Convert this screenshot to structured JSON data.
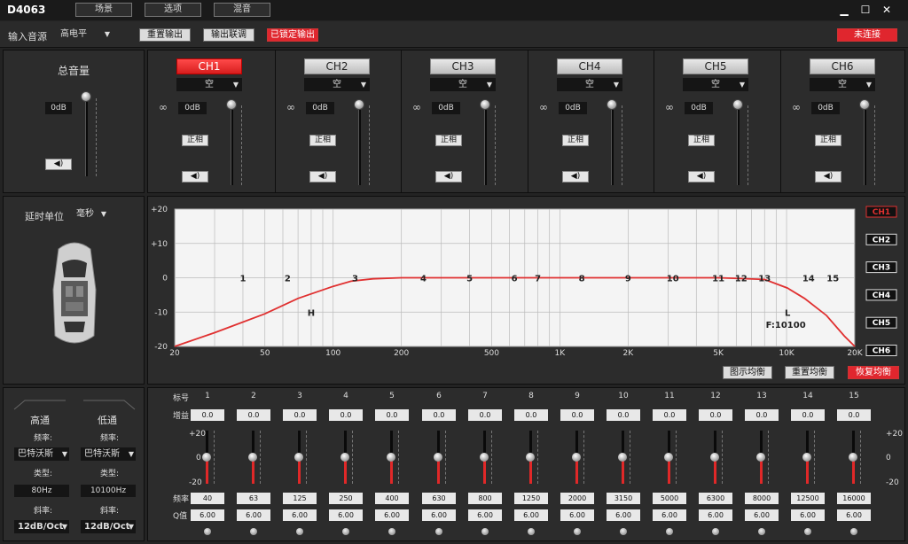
{
  "window": {
    "title": "D4063",
    "menu": [
      "场景",
      "选项",
      "混音"
    ],
    "minimize": "▁",
    "maximize": "☐",
    "close": "✕"
  },
  "toolbar": {
    "input_source_label": "输入音源",
    "input_source_value": "高电平",
    "reset_output": "重置输出",
    "output_link": "输出联调",
    "locked_output": "已锁定输出",
    "connection_status": "未连接"
  },
  "master": {
    "title": "总音量",
    "value": "0dB",
    "level": 1.0
  },
  "channels": [
    {
      "name": "CH1",
      "type": "空",
      "gain": "0dB",
      "phase": "正相",
      "active": true
    },
    {
      "name": "CH2",
      "type": "空",
      "gain": "0dB",
      "phase": "正相",
      "active": false
    },
    {
      "name": "CH3",
      "type": "空",
      "gain": "0dB",
      "phase": "正相",
      "active": false
    },
    {
      "name": "CH4",
      "type": "空",
      "gain": "0dB",
      "phase": "正相",
      "active": false
    },
    {
      "name": "CH5",
      "type": "空",
      "gain": "0dB",
      "phase": "正相",
      "active": false
    },
    {
      "name": "CH6",
      "type": "空",
      "gain": "0dB",
      "phase": "正相",
      "active": false
    }
  ],
  "delay": {
    "unit_label": "延时单位",
    "unit_value": "毫秒"
  },
  "graph": {
    "y_ticks": [
      "+20",
      "+10",
      "0",
      "-10",
      "-20"
    ],
    "x_ticks": [
      "20",
      "50",
      "100",
      "200",
      "500",
      "1K",
      "2K",
      "5K",
      "10K",
      "20K"
    ],
    "band_markers": [
      "1",
      "2",
      "3",
      "4",
      "5",
      "6",
      "7",
      "8",
      "9",
      "10",
      "11",
      "12",
      "13",
      "14",
      "15"
    ],
    "hp_marker": "H",
    "lp_marker": "L",
    "lp_freq_label": "F:10100",
    "channel_labels": [
      "CH1",
      "CH2",
      "CH3",
      "CH4",
      "CH5",
      "CH6"
    ],
    "curve_color": "#e03030",
    "buttons": {
      "graphic_eq": "图示均衡",
      "reset_eq": "重置均衡",
      "restore_eq": "恢复均衡"
    }
  },
  "chart_data": {
    "type": "line",
    "x": [
      20,
      30,
      50,
      70,
      100,
      120,
      150,
      200,
      500,
      1000,
      2000,
      5000,
      8000,
      10100,
      12000,
      15000,
      18000,
      20000
    ],
    "y": [
      -20,
      -16,
      -10.5,
      -6,
      -2.5,
      -1,
      -0.3,
      0,
      0,
      0,
      0,
      0,
      -0.5,
      -3,
      -6,
      -11,
      -17,
      -20
    ],
    "xlim": [
      20,
      20000
    ],
    "ylim": [
      -20,
      20
    ],
    "xscale": "log",
    "grid": true
  },
  "filters": {
    "highpass": {
      "title": "高通",
      "freq_label": "频率:",
      "type_value": "巴特沃斯",
      "type_label": "类型:",
      "freq_value": "80Hz",
      "slope_label": "斜率:",
      "slope_value": "12dB/Oct"
    },
    "lowpass": {
      "title": "低通",
      "freq_label": "频率:",
      "type_value": "巴特沃斯",
      "type_label": "类型:",
      "freq_value": "10100Hz",
      "slope_label": "斜率:",
      "slope_value": "12dB/Oct"
    }
  },
  "eq": {
    "band_label": "标号",
    "gain_label": "增益",
    "freq_label": "频率",
    "q_label": "Q值",
    "scale": [
      "+20",
      "0",
      "-20"
    ],
    "bands": [
      {
        "id": "1",
        "gain": "0.0",
        "freq": "40",
        "q": "6.00"
      },
      {
        "id": "2",
        "gain": "0.0",
        "freq": "63",
        "q": "6.00"
      },
      {
        "id": "3",
        "gain": "0.0",
        "freq": "125",
        "q": "6.00"
      },
      {
        "id": "4",
        "gain": "0.0",
        "freq": "250",
        "q": "6.00"
      },
      {
        "id": "5",
        "gain": "0.0",
        "freq": "400",
        "q": "6.00"
      },
      {
        "id": "6",
        "gain": "0.0",
        "freq": "630",
        "q": "6.00"
      },
      {
        "id": "7",
        "gain": "0.0",
        "freq": "800",
        "q": "6.00"
      },
      {
        "id": "8",
        "gain": "0.0",
        "freq": "1250",
        "q": "6.00"
      },
      {
        "id": "9",
        "gain": "0.0",
        "freq": "2000",
        "q": "6.00"
      },
      {
        "id": "10",
        "gain": "0.0",
        "freq": "3150",
        "q": "6.00"
      },
      {
        "id": "11",
        "gain": "0.0",
        "freq": "5000",
        "q": "6.00"
      },
      {
        "id": "12",
        "gain": "0.0",
        "freq": "6300",
        "q": "6.00"
      },
      {
        "id": "13",
        "gain": "0.0",
        "freq": "8000",
        "q": "6.00"
      },
      {
        "id": "14",
        "gain": "0.0",
        "freq": "12500",
        "q": "6.00"
      },
      {
        "id": "15",
        "gain": "0.0",
        "freq": "16000",
        "q": "6.00"
      }
    ]
  }
}
